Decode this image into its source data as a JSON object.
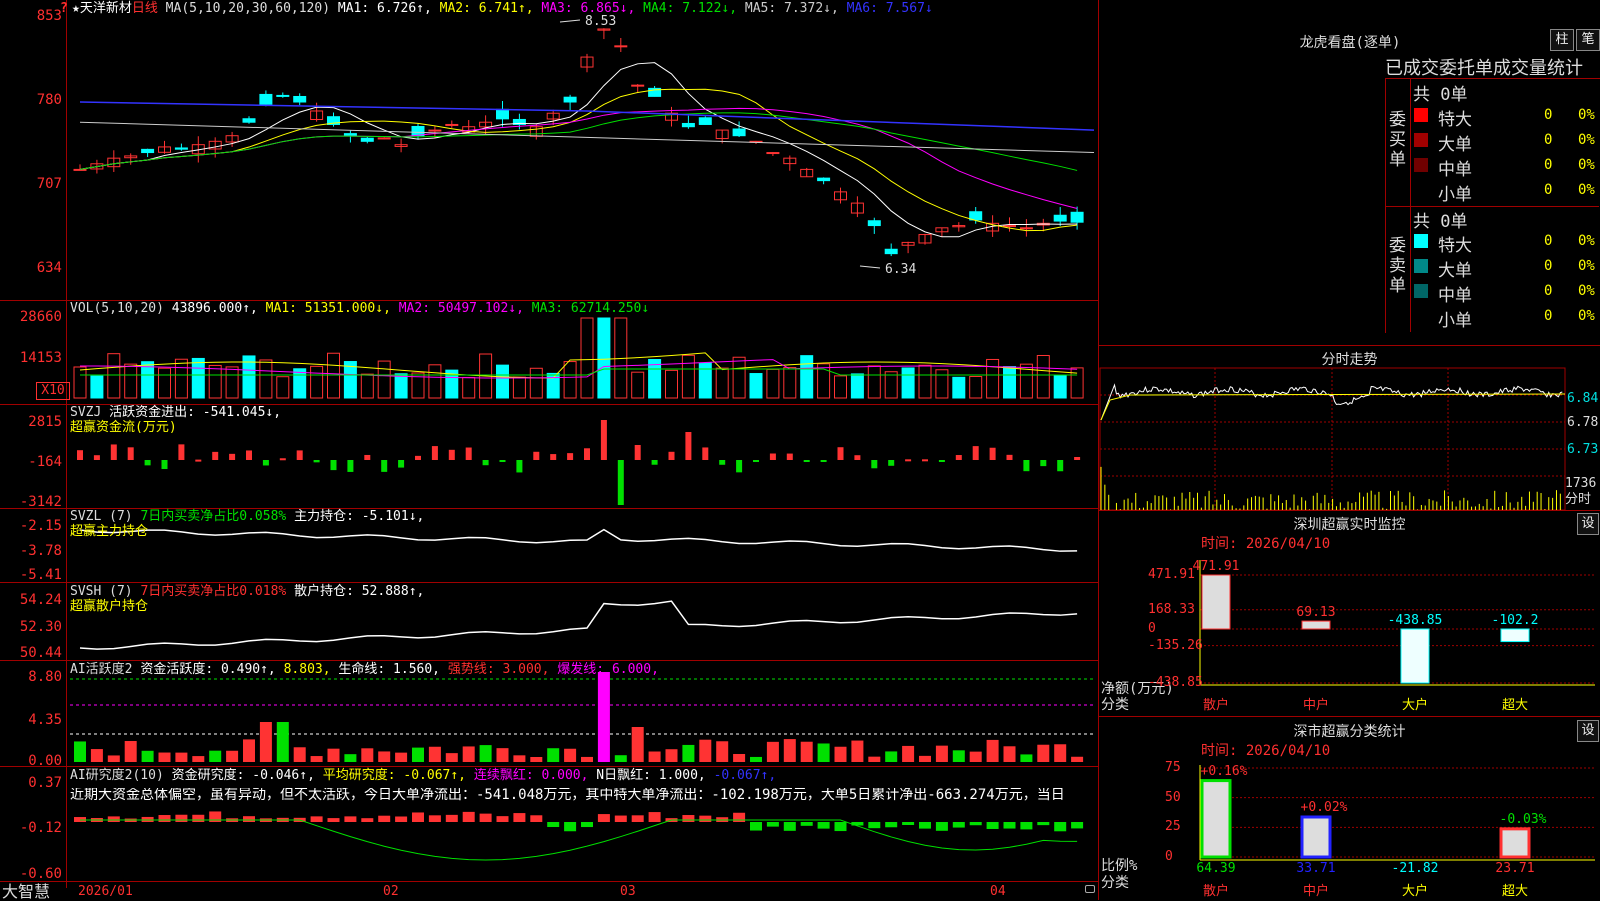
{
  "colors": {
    "up": "#ff3333",
    "down": "#00ffff",
    "green": "#00e000",
    "yellow": "#ffff00",
    "magenta": "#ff00ff",
    "blue": "#3333ff",
    "white": "#ffffff",
    "grid": "#a00000"
  },
  "main": {
    "stock_name": "★天洋新材",
    "period": "日线",
    "ma_def": "MA(5,10,20,30,60,120)",
    "ma": [
      {
        "label": "MA1: 6.726↑,",
        "color": "#ffffff"
      },
      {
        "label": "MA2: 6.741↑,",
        "color": "#ffff00"
      },
      {
        "label": "MA3: 6.865↓,",
        "color": "#ff00ff"
      },
      {
        "label": "MA4: 7.122↓,",
        "color": "#00e000"
      },
      {
        "label": "MA5: 7.372↓,",
        "color": "#cccccc"
      },
      {
        "label": "MA6: 7.567↓",
        "color": "#3333ff"
      }
    ],
    "y_ticks": [
      "853",
      "780",
      "707",
      "634"
    ],
    "high_label": "8.53",
    "low_label": "6.34",
    "corner": "?"
  },
  "volume": {
    "def": "VOL(5,10,20)",
    "value": "43896.000↑,",
    "ma1": "MA1: 51351.000↓,",
    "ma2": "MA2: 50497.102↓,",
    "ma3": "MA3: 62714.250↓",
    "y_ticks": [
      "28660",
      "14153"
    ],
    "unit": "X10"
  },
  "svzj": {
    "def": "SVZJ",
    "label": "活跃资金进出: -541.045↓,",
    "sub": "超赢资金流(万元)",
    "y_ticks": [
      "2815",
      "-164",
      "-3142"
    ]
  },
  "svzl": {
    "def": "SVZL (7)",
    "ratio": "7日内买卖净占比0.058%",
    "label": "主力持仓: -5.101↓,",
    "sub": "超赢主力持仓",
    "y_ticks": [
      "-2.15",
      "-3.78",
      "-5.41"
    ]
  },
  "svsh": {
    "def": "SVSH (7)",
    "ratio": "7日内买卖净占比0.018%",
    "label": "散户持仓: 52.888↑,",
    "sub": "超赢散户持仓",
    "y_ticks": [
      "54.24",
      "52.30",
      "50.44"
    ]
  },
  "ai_active": {
    "def": "AI活跃度2",
    "label1": "资金活跃度: 0.490↑,",
    "label2": "8.803,",
    "label3": "生命线: 1.560,",
    "label4": "强势线: 3.000,",
    "label5": "爆发线: 6.000,",
    "y_ticks": [
      "8.80",
      "4.35",
      "0.00"
    ]
  },
  "ai_research": {
    "def": "AI研究度2(10)",
    "label1": "资金研究度: -0.046↑,",
    "label2": "平均研究度: -0.067↑,",
    "label3": "连续飘红: 0.000,",
    "label4": "N日飘红: 1.000,",
    "label5": "-0.067↑,",
    "commentary": "近期大资金总体偏空，虽有异动，但不太活跃，今日大单净流出：-541.048万元，其中特大单净流出：-102.198万元，大单5日累计净出-663.274万元，当日",
    "y_ticks": [
      "0.37",
      "-0.12",
      "-0.60"
    ]
  },
  "x_axis": {
    "labels": [
      "2026/01",
      "02",
      "03",
      "04"
    ],
    "brand": "大智慧"
  },
  "right": {
    "title": "龙虎看盘(逐单)",
    "btn_bar": "柱",
    "btn_tick": "笔",
    "stats_title": "已成交委托单成交量统计",
    "buy": {
      "group": "委买单",
      "total": "共 0单",
      "rows": [
        {
          "name": "特大",
          "count": "0",
          "pct": "0%",
          "color": "#ff0000"
        },
        {
          "name": "大单",
          "count": "0",
          "pct": "0%",
          "color": "#a00000"
        },
        {
          "name": "中单",
          "count": "0",
          "pct": "0%",
          "color": "#700000"
        },
        {
          "name": "小单",
          "count": "0",
          "pct": "0%",
          "color": "#000000"
        }
      ]
    },
    "sell": {
      "group": "委卖单",
      "total": "共 0单",
      "rows": [
        {
          "name": "特大",
          "count": "0",
          "pct": "0%",
          "color": "#00ffff"
        },
        {
          "name": "大单",
          "count": "0",
          "pct": "0%",
          "color": "#008888"
        },
        {
          "name": "中单",
          "count": "0",
          "pct": "0%",
          "color": "#006666"
        },
        {
          "name": "小单",
          "count": "0",
          "pct": "0%",
          "color": "#000000"
        }
      ]
    },
    "intraday": {
      "title": "分时走势",
      "price_ticks": [
        "6.84",
        "6.78",
        "6.73"
      ],
      "vol_tick": "1736",
      "vol_unit": "分时"
    },
    "monitor": {
      "title": "深圳超赢实时监控",
      "setting": "设",
      "time": "时间: 2026/04/10",
      "y_ticks": [
        "471.91",
        "168.33",
        "0",
        "-135.26",
        "-438.85"
      ],
      "bars": [
        {
          "cat": "散户",
          "value": 471.91,
          "label": "471.91"
        },
        {
          "cat": "中户",
          "value": 69.13,
          "label": "69.13"
        },
        {
          "cat": "大户",
          "value": -438.85,
          "label": "-438.85"
        },
        {
          "cat": "超大",
          "value": -102.2,
          "label": "-102.2"
        }
      ],
      "ylabel": "净额(万元)",
      "xlabel": "分类"
    },
    "category": {
      "title": "深市超赢分类统计",
      "setting": "设",
      "time": "时间: 2026/04/10",
      "y_ticks": [
        "75",
        "50",
        "25",
        "0"
      ],
      "bars": [
        {
          "cat": "散户",
          "value": 64.39,
          "top": "+0.16%",
          "bottom": "64.39"
        },
        {
          "cat": "中户",
          "value": 33.71,
          "top": "+0.02%",
          "bottom": "33.71"
        },
        {
          "cat": "大户",
          "value": -21.82,
          "top": "",
          "bottom": "-21.82"
        },
        {
          "cat": "超大",
          "value": 23.71,
          "top": "-0.03%",
          "bottom": "23.71"
        }
      ],
      "ylabel": "比例%",
      "xlabel": "分类"
    }
  }
}
